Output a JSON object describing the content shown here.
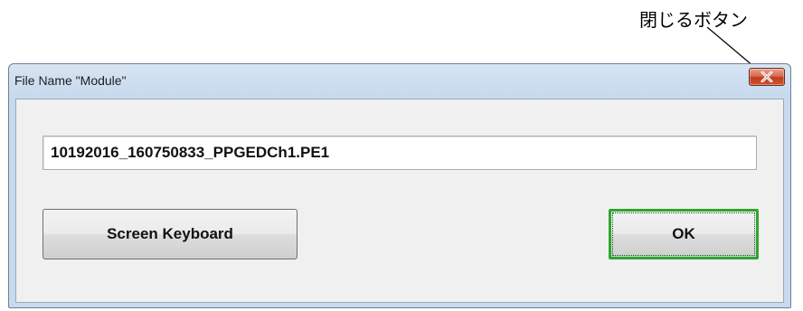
{
  "annotation": {
    "label": "閉じるボタン"
  },
  "dialog": {
    "title": "File Name \"Module\"",
    "close_icon": "close-x-icon",
    "filename_value": "10192016_160750833_PPGEDCh1.PE1",
    "keyboard_button_label": "Screen Keyboard",
    "ok_button_label": "OK"
  },
  "colors": {
    "close_button": "#c9452a",
    "ok_focus_border": "#2fa52f",
    "titlebar": "#c9dbee",
    "client_background": "#f0f0f0"
  }
}
